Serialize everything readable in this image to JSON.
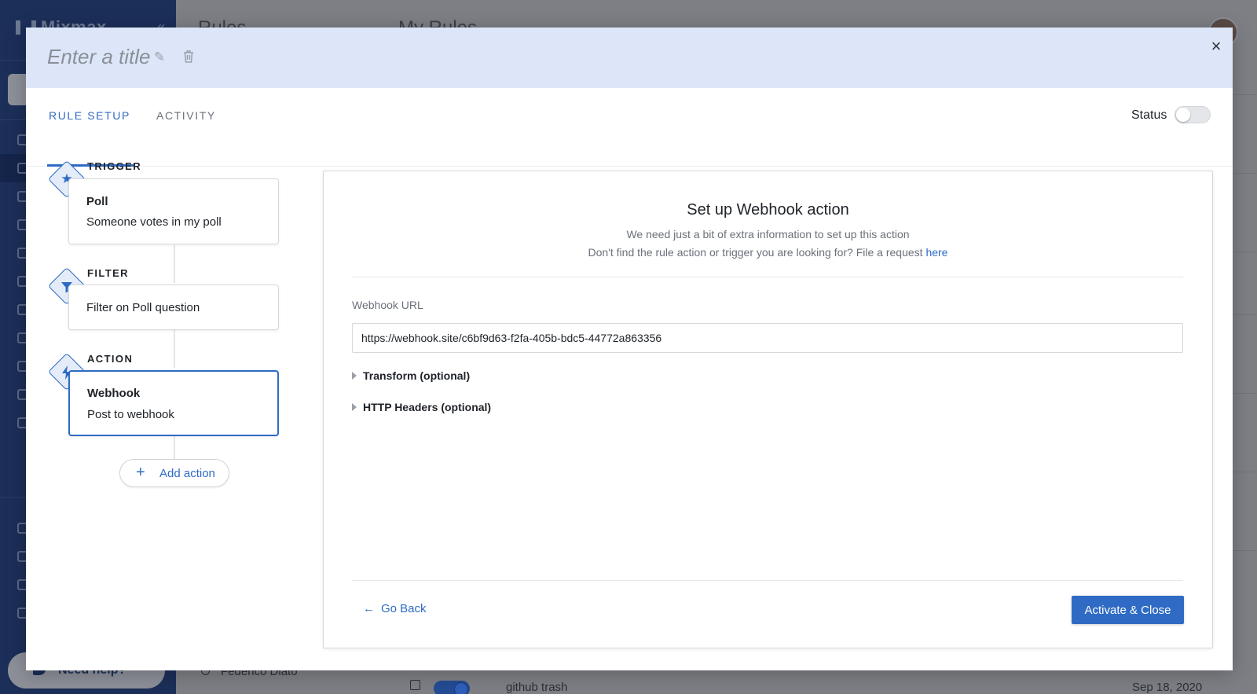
{
  "background": {
    "app_name": "Mixmax",
    "page_title": "Rules",
    "section_title": "My Rules",
    "help_label": "Need help?",
    "user_name": "Federico Diato",
    "rule_row": {
      "name": "github trash",
      "date": "Sep 18, 2020"
    }
  },
  "modal": {
    "title_placeholder": "Enter a title",
    "close_icon": "×",
    "tabs": [
      {
        "label": "RULE SETUP",
        "active": true
      },
      {
        "label": "ACTIVITY",
        "active": false
      }
    ],
    "status_label": "Status",
    "status_on": false,
    "steps": [
      {
        "kind": "TRIGGER",
        "icon": "star-icon",
        "title": "Poll",
        "subtitle": "Someone votes in my poll"
      },
      {
        "kind": "FILTER",
        "icon": "filter-icon",
        "title": "",
        "subtitle": "Filter on Poll question"
      },
      {
        "kind": "ACTION",
        "icon": "lightning-icon",
        "title": "Webhook",
        "subtitle": "Post to webhook"
      }
    ],
    "add_action_label": "Add action",
    "panel": {
      "title": "Set up Webhook action",
      "subtitle_line1": "We need just a bit of extra information to set up this action",
      "subtitle_line2": "Don't find the rule action or trigger you are looking for? File a request",
      "subtitle_link": "here",
      "webhook_label": "Webhook URL",
      "webhook_value": "https://webhook.site/c6bf9d63-f2fa-405b-bdc5-44772a863356",
      "transform_label": "Transform (optional)",
      "headers_label": "HTTP Headers (optional)",
      "go_back_label": "Go Back",
      "activate_label": "Activate & Close"
    }
  },
  "colors": {
    "accent": "#2f6bc4",
    "header_bg": "#dce6f8",
    "sidebar_bg": "#1c2f59"
  }
}
